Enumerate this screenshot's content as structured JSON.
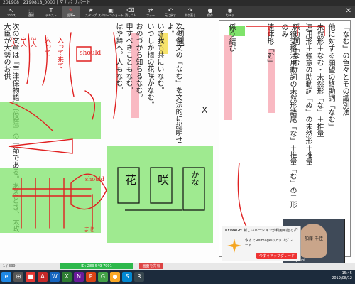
{
  "window": {
    "title": "201908 | 2190818_0000 | マナポ サポート"
  },
  "toolbar": {
    "items": [
      {
        "id": "mouse",
        "label": "マウス",
        "icon": "↖"
      },
      {
        "id": "select",
        "label": "選択",
        "icon": "⬚"
      },
      {
        "id": "text",
        "label": "テキスト",
        "icon": "T"
      },
      {
        "id": "pen",
        "label": "鉛筆▾",
        "icon": "✎"
      },
      {
        "id": "stamp",
        "label": "スタンプ",
        "icon": "★"
      },
      {
        "id": "shot",
        "label": "スクリーンショット",
        "icon": "▣"
      },
      {
        "id": "clear",
        "label": "消しゴム",
        "icon": "⌫"
      },
      {
        "id": "share",
        "label": "フォー",
        "icon": "⇄"
      },
      {
        "id": "undo",
        "label": "元に戻す",
        "icon": "↶"
      },
      {
        "id": "redo",
        "label": "やり直し",
        "icon": "↷"
      },
      {
        "id": "record",
        "label": "保存",
        "icon": "●"
      },
      {
        "id": "camera",
        "label": "カメラ",
        "icon": "◉"
      }
    ],
    "close": "✕"
  },
  "document": {
    "left_text": [
      "次の文章は『宇津保物語』〔俊蔭〕の一節である。あるとき、太政大臣が大勢のお供"
    ],
    "hw_left": [
      "入って来て",
      "入って",
      "3人",
      "4人",
      "5人"
    ],
    "hw_center": [
      "should",
      "should",
      "まじ",
      "花",
      "咲",
      "かな"
    ],
    "mid_cols": [
      "【問題】",
      "次の各文の「なむ」を文法的に説明せよ。",
      "いざ我も共にいなむ。",
      "いつしか梅の花咲かなむ。",
      "おのづから知らるなむ。",
      "申すべきこともなむ。",
      "はや舞へ。人もなむ。"
    ],
    "mid_numbers": [
      "①",
      "②",
      "③",
      "④",
      "⑤"
    ],
    "x_mark": "X",
    "right_header": "「なむ」の色々とその識別法",
    "right_cols": [
      "他に対する願望の終助詞「なむ」",
      "未然形＋なむ・未然形「な」＋推量",
      "連用形＋強意の助動詞「ぬ」の未然形＋推量",
      "係助詞「なむ」",
      "ナ行変格活用動詞の未然形語尾「な」＋推量「む」の二形のみ",
      "連体形「む」",
      "係り結び"
    ],
    "right_numbers": [
      "①",
      "②",
      "③",
      "④"
    ]
  },
  "video": {
    "caption": "takeo yoshi...",
    "name": "加藤 千佳"
  },
  "notification": {
    "title": "REIMAGE: 新しいバージョンが利用可能です",
    "body": "今すぐReimageのアップグレード",
    "button": "今すぐアップグレード",
    "close": "✕"
  },
  "bottom": {
    "page": "1 / 339",
    "green": "ID: 283 549 7991",
    "redpill": "画面を共有"
  },
  "taskbar": {
    "apps": [
      "e",
      "⊞",
      "■",
      "A",
      "W",
      "X",
      "N",
      "P",
      "G",
      "●",
      "S",
      "R"
    ],
    "time": "15:45",
    "date": "2019/08/12"
  },
  "colors": {
    "highlight_green": "#7fe36b",
    "highlight_pink": "#f7a7b3",
    "ink_red": "#e02020"
  }
}
